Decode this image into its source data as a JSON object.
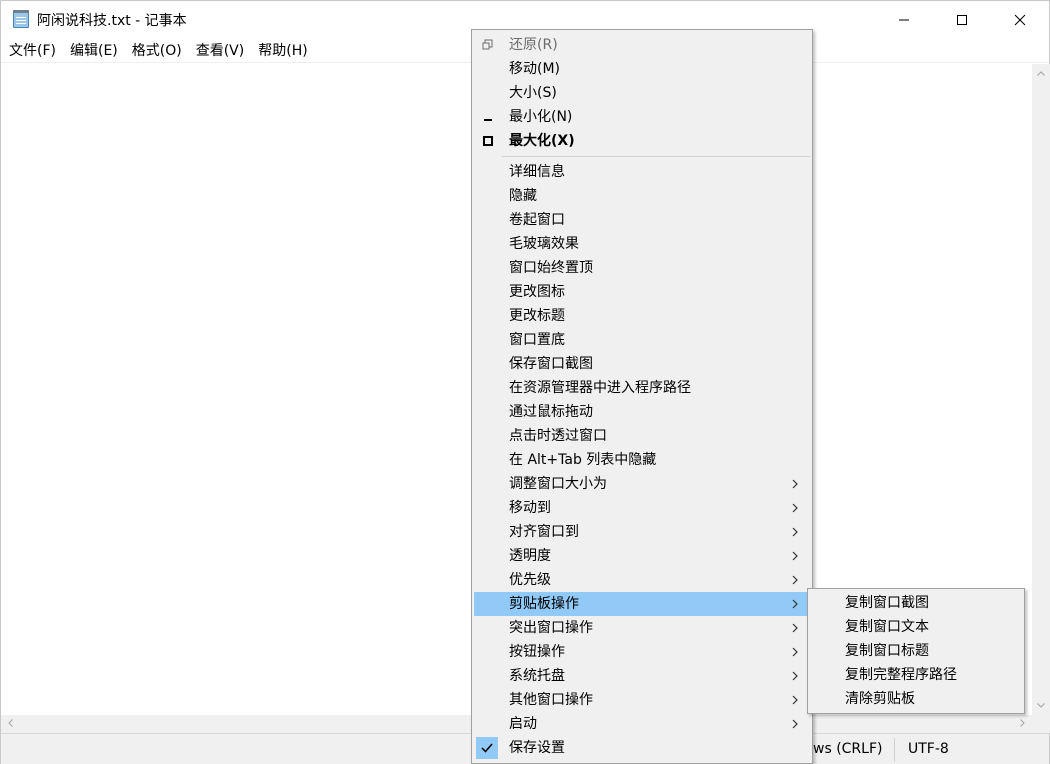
{
  "window": {
    "title": "阿闲说科技.txt - 记事本",
    "controls": {
      "minimize_icon": "minimize-icon",
      "maximize_icon": "maximize-icon",
      "close_icon": "close-icon"
    }
  },
  "menubar": {
    "items": [
      {
        "label": "文件(F)"
      },
      {
        "label": "编辑(E)"
      },
      {
        "label": "格式(O)"
      },
      {
        "label": "查看(V)"
      },
      {
        "label": "帮助(H)"
      }
    ]
  },
  "statusbar": {
    "line_ending": "ws (CRLF)",
    "encoding": "UTF-8"
  },
  "context_menu": {
    "items": [
      {
        "label": "还原(R)"
      },
      {
        "label": "移动(M)"
      },
      {
        "label": "大小(S)"
      },
      {
        "label": "最小化(N)"
      },
      {
        "label": "最大化(X)"
      },
      {
        "label": "详细信息"
      },
      {
        "label": "隐藏"
      },
      {
        "label": "卷起窗口"
      },
      {
        "label": "毛玻璃效果"
      },
      {
        "label": "窗口始终置顶"
      },
      {
        "label": "更改图标"
      },
      {
        "label": "更改标题"
      },
      {
        "label": "窗口置底"
      },
      {
        "label": "保存窗口截图"
      },
      {
        "label": "在资源管理器中进入程序路径"
      },
      {
        "label": "通过鼠标拖动"
      },
      {
        "label": "点击时透过窗口"
      },
      {
        "label": "在 Alt+Tab 列表中隐藏"
      },
      {
        "label": "调整窗口大小为"
      },
      {
        "label": "移动到"
      },
      {
        "label": "对齐窗口到"
      },
      {
        "label": "透明度"
      },
      {
        "label": "优先级"
      },
      {
        "label": "剪贴板操作"
      },
      {
        "label": "突出窗口操作"
      },
      {
        "label": "按钮操作"
      },
      {
        "label": "系统托盘"
      },
      {
        "label": "其他窗口操作"
      },
      {
        "label": "启动"
      },
      {
        "label": "保存设置"
      }
    ]
  },
  "clipboard_submenu": {
    "items": [
      {
        "label": "复制窗口截图"
      },
      {
        "label": "复制窗口文本"
      },
      {
        "label": "复制窗口标题"
      },
      {
        "label": "复制完整程序路径"
      },
      {
        "label": "清除剪贴板"
      }
    ]
  },
  "colors": {
    "highlight": "#91c9f7",
    "menu_background": "#f0f0f0",
    "disabled_text": "#6d6d6d"
  }
}
